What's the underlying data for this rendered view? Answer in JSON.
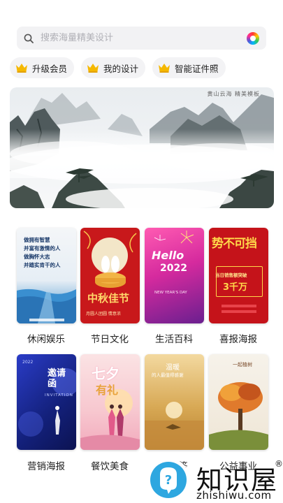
{
  "search": {
    "placeholder": "搜索海量精美设计",
    "icon": "search-icon",
    "right_icon": "color-wheel-icon"
  },
  "chips": [
    {
      "label": "升级会员",
      "icon": "crown-icon"
    },
    {
      "label": "我的设计",
      "icon": "crown-icon"
    },
    {
      "label": "智能证件照",
      "icon": "crown-icon"
    }
  ],
  "banner": {
    "stamp": "黄山云海 精美模板"
  },
  "categories": [
    {
      "label": "休闲娱乐",
      "card_text": [
        "做拥有智慧",
        "并富有激情的人",
        "做胸怀大志",
        "并踏实肯干的人"
      ]
    },
    {
      "label": "节日文化",
      "card_text": [
        "中秋佳节",
        "月圆人团圆 情意浓"
      ]
    },
    {
      "label": "生活百科",
      "card_text": [
        "Hello",
        "2022",
        "NEW YEAR'S DAY"
      ]
    },
    {
      "label": "喜报海报",
      "card_text": [
        "势不可挡",
        "当日销售额突破",
        "3千万"
      ]
    },
    {
      "label": "营销海报",
      "card_text": [
        "2022",
        "邀请函",
        "INVITATION"
      ]
    },
    {
      "label": "餐饮美食",
      "card_text": [
        "七夕",
        "有礼"
      ]
    },
    {
      "label": "签",
      "card_text": [
        "温暖",
        "的人最值得感谢"
      ]
    },
    {
      "label": "公益事业",
      "card_text": [
        "一起植树"
      ]
    }
  ],
  "watermark": {
    "title": "知识屋",
    "url": "zhishiwu.com",
    "reg": "®"
  },
  "colors": {
    "accent": "#f5b800",
    "card_red": "#d81e1e",
    "card_blue": "#1b2a8a"
  }
}
